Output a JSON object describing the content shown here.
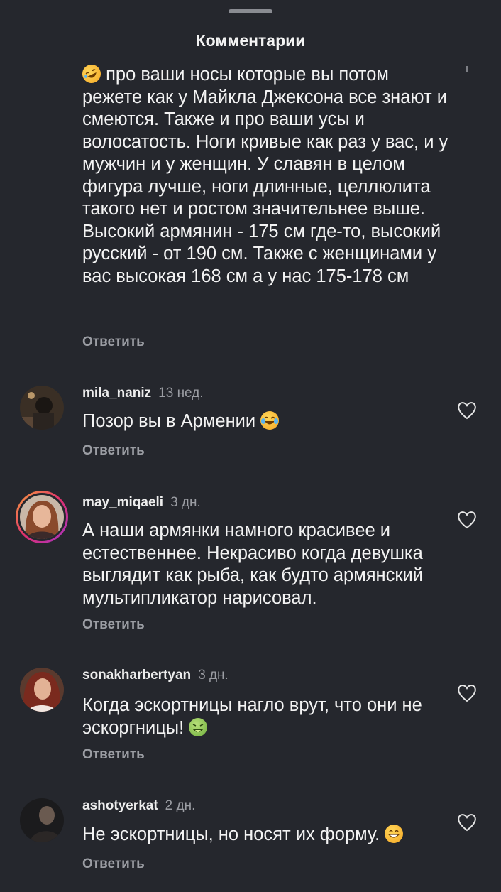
{
  "sheet": {
    "title": "Комментарии"
  },
  "comments": [
    {
      "text": "про ваши носы которые вы потом режете как у Майкла Джексона все знают и смеются. Также и про ваши усы и волосатость. Ноги кривые как раз у вас, и у мужчин и у женщин. У славян в целом фигура лучше, ноги длинные, целлюлита такого нет и ростом значительнее выше. Высокий армянин - 175 см где-то, высокий русский - от 190 см. Также с женщинами у вас высокая 168 см а у нас 175-178 см",
      "leading_emoji": "rolling-on-floor-laughing-emoji",
      "reply_label": "Ответить"
    },
    {
      "username": "mila_naniz",
      "time": "13 нед.",
      "text": "Позор вы в Армении",
      "trailing_emoji": "tears-of-joy-emoji",
      "reply_label": "Ответить",
      "has_story_ring": false
    },
    {
      "username": "may_miqaeli",
      "time": "3 дн.",
      "text": "А наши армянки намного красивее и естественнее. Некрасиво когда девушка выглядит как рыба, как будто армянский мультипликатор нарисовал.",
      "reply_label": "Ответить",
      "has_story_ring": true
    },
    {
      "username": "sonakharbertyan",
      "time": "3 дн.",
      "text": "Когда эскортницы нагло врут, что они не эскоргницы!",
      "trailing_emoji": "nauseated-face-emoji",
      "reply_label": "Ответить",
      "has_story_ring": false
    },
    {
      "username": "ashotyerkat",
      "time": "2 дн.",
      "text": "Не эскортницы, но носят их форму.",
      "trailing_emoji": "grinning-face-emoji",
      "reply_label": "Ответить",
      "has_story_ring": false
    }
  ],
  "colors": {
    "background": "#25272d",
    "text": "#f3f3f3",
    "secondary_text": "#9b9da3"
  }
}
